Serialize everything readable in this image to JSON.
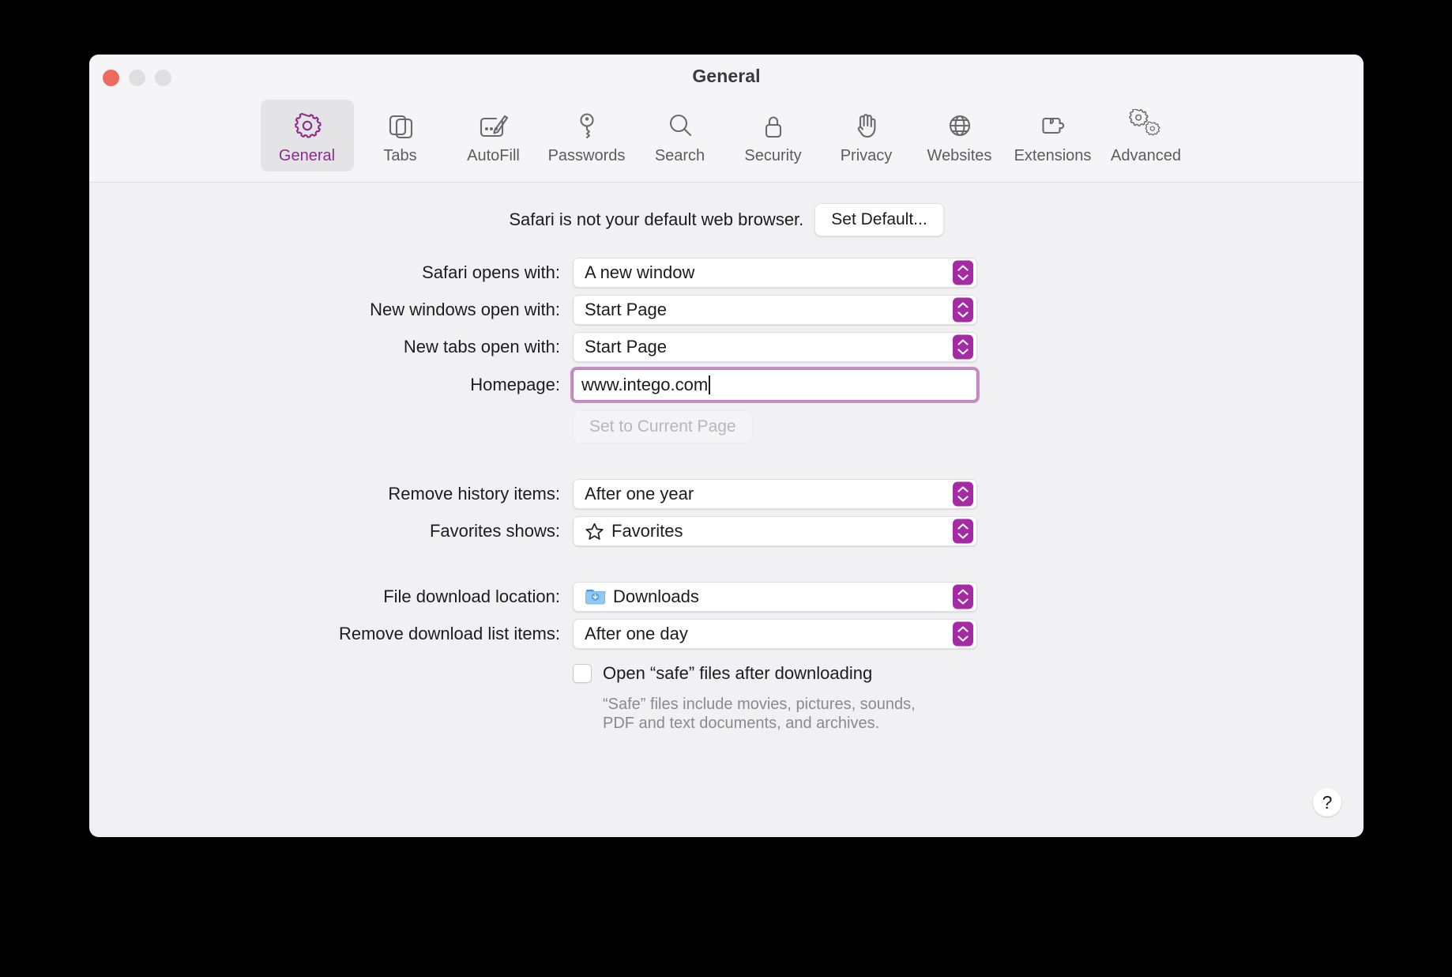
{
  "window": {
    "title": "General",
    "traffic_lights": [
      "close-button",
      "minimize-button",
      "zoom-button"
    ]
  },
  "toolbar": {
    "tabs": [
      {
        "label": "General",
        "icon": "gear-icon",
        "selected": true
      },
      {
        "label": "Tabs",
        "icon": "tabs-icon",
        "selected": false
      },
      {
        "label": "AutoFill",
        "icon": "autofill-icon",
        "selected": false
      },
      {
        "label": "Passwords",
        "icon": "key-icon",
        "selected": false
      },
      {
        "label": "Search",
        "icon": "search-icon",
        "selected": false
      },
      {
        "label": "Security",
        "icon": "lock-icon",
        "selected": false
      },
      {
        "label": "Privacy",
        "icon": "hand-icon",
        "selected": false
      },
      {
        "label": "Websites",
        "icon": "globe-icon",
        "selected": false
      },
      {
        "label": "Extensions",
        "icon": "puzzle-icon",
        "selected": false
      },
      {
        "label": "Advanced",
        "icon": "gears-icon",
        "selected": false
      }
    ]
  },
  "default_browser": {
    "message": "Safari is not your default web browser.",
    "button_label": "Set Default..."
  },
  "settings": {
    "safari_opens_with": {
      "label": "Safari opens with:",
      "value": "A new window"
    },
    "new_windows_open_with": {
      "label": "New windows open with:",
      "value": "Start Page"
    },
    "new_tabs_open_with": {
      "label": "New tabs open with:",
      "value": "Start Page"
    },
    "homepage": {
      "label": "Homepage:",
      "value": "www.intego.com"
    },
    "set_to_current_page": {
      "label": "Set to Current Page",
      "enabled": false
    },
    "remove_history_items": {
      "label": "Remove history items:",
      "value": "After one year"
    },
    "favorites_shows": {
      "label": "Favorites shows:",
      "value": "Favorites",
      "icon": "star-icon"
    },
    "file_download_location": {
      "label": "File download location:",
      "value": "Downloads",
      "icon": "downloads-folder-icon"
    },
    "remove_download_list_items": {
      "label": "Remove download list items:",
      "value": "After one day"
    },
    "open_safe_files": {
      "label": "Open “safe” files after downloading",
      "checked": false,
      "help_line_1": "“Safe” files include movies, pictures, sounds,",
      "help_line_2": "PDF and text documents, and archives."
    }
  },
  "help": {
    "label": "?"
  },
  "colors": {
    "accent_purple": "#a52ba5",
    "selected_tab_bg": "#e4e4e7",
    "window_bg": "#f1f1f4",
    "titlebar_bg": "#f5f5f7",
    "close_red": "#ec6a5f",
    "folder_blue": "#56a7e8"
  }
}
